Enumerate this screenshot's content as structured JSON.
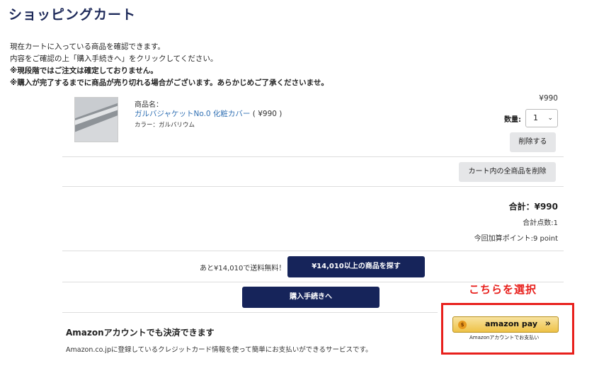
{
  "page": {
    "title": "ショッピングカート"
  },
  "intro": {
    "line1": "現在カートに入っている商品を確認できます。",
    "line2": "内容をご確認の上「購入手続きへ」をクリックしてください。",
    "line3": "※現段階ではご注文は確定しておりません。",
    "line4": "※購入が完了するまでに商品が売り切れる場合がございます。あらかじめご了承くださいませ。"
  },
  "cart_item": {
    "label": "商品名：",
    "name": "ガルバジャケットNo.0 化粧カバー",
    "price_paren": "( ¥990 )",
    "color": "カラー：ガルバリウム",
    "unit_price": "¥990",
    "qty_label": "数量:",
    "qty_value": "1",
    "delete_label": "削除する"
  },
  "cart_actions": {
    "delete_all_label": "カート内の全商品を削除"
  },
  "summary": {
    "total": "合計：¥990",
    "count": "合計点数:1",
    "points": "今回加算ポイント:9 point"
  },
  "shipping": {
    "free_text": "あと¥14,010で送料無料！",
    "find_button": "¥14,010以上の商品を探す"
  },
  "checkout": {
    "button": "購入手続きへ"
  },
  "annotation": {
    "text": "こちらを選択",
    "color": "#e8201c"
  },
  "amazon_pay": {
    "wordmark": "amazon pay",
    "arrows": "»",
    "coin": "$",
    "sub": "Amazonアカウントでお支払い",
    "title": "Amazonアカウントでも決済できます",
    "desc": "Amazon.co.jpに登録しているクレジットカード情報を使って簡単にお支払いができるサービスです。"
  },
  "colors": {
    "navy": "#16245a",
    "link": "#2f6fb3",
    "amazon_gold": "#eec247"
  }
}
